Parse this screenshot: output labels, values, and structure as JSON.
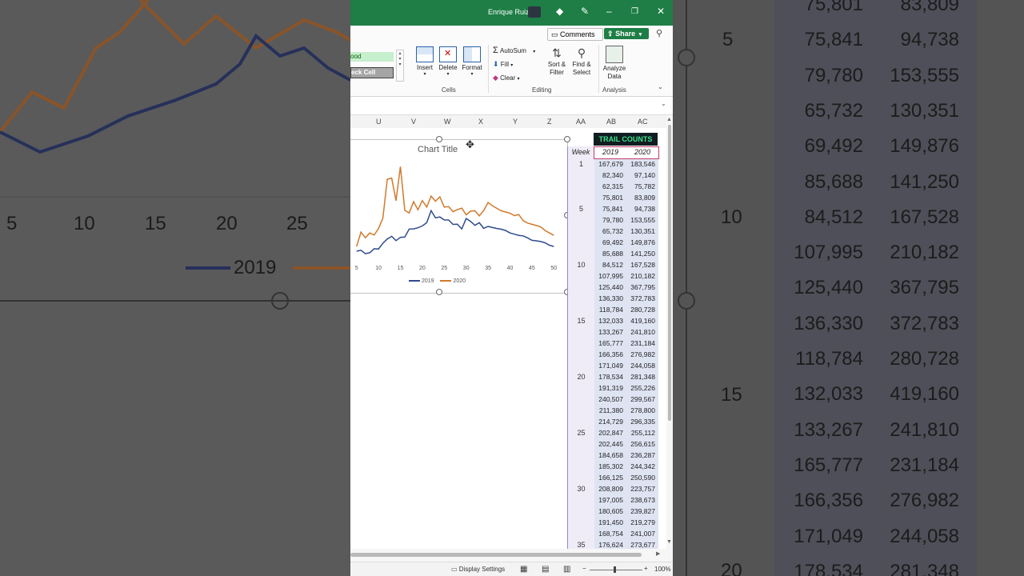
{
  "titlebar": {
    "user": "Enrique Ruiz"
  },
  "ribbon": {
    "comments": "Comments",
    "share": "Share",
    "styles": {
      "good": "ood",
      "check_cell": "eck Cell"
    },
    "cells": {
      "insert": "Insert",
      "delete": "Delete",
      "format": "Format",
      "group": "Cells"
    },
    "editing": {
      "autosum": "AutoSum",
      "fill": "Fill",
      "clear": "Clear",
      "sort_filter": "Sort & Filter",
      "find_select": "Find & Select",
      "group": "Editing"
    },
    "analysis": {
      "analyze_data": "Analyze Data",
      "group": "Analysis"
    }
  },
  "columns": [
    "U",
    "V",
    "W",
    "X",
    "Y",
    "Z",
    "AA",
    "AB",
    "AC"
  ],
  "chart": {
    "title": "Chart Title",
    "legend": [
      "2019",
      "2020"
    ]
  },
  "chart_data": {
    "type": "line",
    "title": "Chart Title",
    "x": [
      1,
      2,
      3,
      4,
      5,
      6,
      7,
      8,
      9,
      10,
      11,
      12,
      13,
      14,
      15,
      16,
      17,
      18,
      19,
      20,
      21,
      22,
      23,
      24,
      25,
      26,
      27,
      28,
      29,
      30,
      31,
      32,
      33,
      34,
      35,
      36,
      37,
      38,
      39,
      40,
      41,
      42,
      43,
      44,
      45,
      46,
      47,
      48,
      49,
      50,
      51
    ],
    "xticks": [
      5,
      10,
      15,
      20,
      25,
      30,
      35,
      40,
      45,
      50
    ],
    "series": [
      {
        "name": "2019",
        "color": "#2f4b8c",
        "values": [
          167679,
          82340,
          62315,
          75801,
          75841,
          79780,
          65732,
          69492,
          85688,
          84512,
          107995,
          125440,
          136330,
          118784,
          132033,
          133267,
          165777,
          166356,
          171049,
          178534,
          191319,
          240507,
          211380,
          214729,
          202847,
          202445,
          184658,
          185302,
          166125,
          208809,
          197005,
          180605,
          191450,
          168754,
          176624,
          172000,
          168000,
          165000,
          160000,
          150000,
          145000,
          140000,
          138000,
          130000,
          120000,
          118000,
          115000,
          110000,
          100000,
          95000,
          90000
        ]
      },
      {
        "name": "2020",
        "color": "#d07a2d",
        "values": [
          183546,
          97140,
          75782,
          83809,
          94738,
          153555,
          130351,
          149876,
          141250,
          167528,
          210182,
          367795,
          372783,
          280728,
          419160,
          241810,
          231184,
          276982,
          244058,
          281348,
          255226,
          299567,
          278800,
          296335,
          255112,
          256615,
          236287,
          244342,
          250590,
          223757,
          238673,
          239827,
          219279,
          241007,
          273677,
          260000,
          250000,
          240000,
          235000,
          230000,
          220000,
          225000,
          200000,
          190000,
          185000,
          180000,
          175000,
          160000,
          150000,
          140000,
          130000
        ]
      }
    ]
  },
  "table": {
    "header": "TRAIL COUNTS",
    "week_label": "Week",
    "years": [
      "2019",
      "2020"
    ],
    "week_markers": [
      "1",
      "5",
      "10",
      "15",
      "20",
      "25",
      "30",
      "35"
    ],
    "rows": [
      [
        "167,679",
        "183,546"
      ],
      [
        "82,340",
        "97,140"
      ],
      [
        "62,315",
        "75,782"
      ],
      [
        "75,801",
        "83,809"
      ],
      [
        "75,841",
        "94,738"
      ],
      [
        "79,780",
        "153,555"
      ],
      [
        "65,732",
        "130,351"
      ],
      [
        "69,492",
        "149,876"
      ],
      [
        "85,688",
        "141,250"
      ],
      [
        "84,512",
        "167,528"
      ],
      [
        "107,995",
        "210,182"
      ],
      [
        "125,440",
        "367,795"
      ],
      [
        "136,330",
        "372,783"
      ],
      [
        "118,784",
        "280,728"
      ],
      [
        "132,033",
        "419,160"
      ],
      [
        "133,267",
        "241,810"
      ],
      [
        "165,777",
        "231,184"
      ],
      [
        "166,356",
        "276,982"
      ],
      [
        "171,049",
        "244,058"
      ],
      [
        "178,534",
        "281,348"
      ],
      [
        "191,319",
        "255,226"
      ],
      [
        "240,507",
        "299,567"
      ],
      [
        "211,380",
        "278,800"
      ],
      [
        "214,729",
        "296,335"
      ],
      [
        "202,847",
        "255,112"
      ],
      [
        "202,445",
        "256,615"
      ],
      [
        "184,658",
        "236,287"
      ],
      [
        "185,302",
        "244,342"
      ],
      [
        "166,125",
        "250,590"
      ],
      [
        "208,809",
        "223,757"
      ],
      [
        "197,005",
        "238,673"
      ],
      [
        "180,605",
        "239,827"
      ],
      [
        "191,450",
        "219,279"
      ],
      [
        "168,754",
        "241,007"
      ],
      [
        "176,624",
        "273,677"
      ]
    ]
  },
  "status": {
    "display_settings": "Display Settings",
    "zoom": "100%"
  },
  "background": {
    "left_ticks": [
      "5",
      "10",
      "15",
      "20",
      "25"
    ],
    "left_legend": "2019",
    "right_weeks": [
      "5",
      "10",
      "15",
      "20"
    ],
    "right_rows": [
      [
        "75,801",
        "83,809"
      ],
      [
        "75,841",
        "94,738"
      ],
      [
        "79,780",
        "153,555"
      ],
      [
        "65,732",
        "130,351"
      ],
      [
        "69,492",
        "149,876"
      ],
      [
        "85,688",
        "141,250"
      ],
      [
        "84,512",
        "167,528"
      ],
      [
        "107,995",
        "210,182"
      ],
      [
        "125,440",
        "367,795"
      ],
      [
        "136,330",
        "372,783"
      ],
      [
        "118,784",
        "280,728"
      ],
      [
        "132,033",
        "419,160"
      ],
      [
        "133,267",
        "241,810"
      ],
      [
        "165,777",
        "231,184"
      ],
      [
        "166,356",
        "276,982"
      ],
      [
        "171,049",
        "244,058"
      ],
      [
        "178,534",
        "281,348"
      ]
    ]
  }
}
